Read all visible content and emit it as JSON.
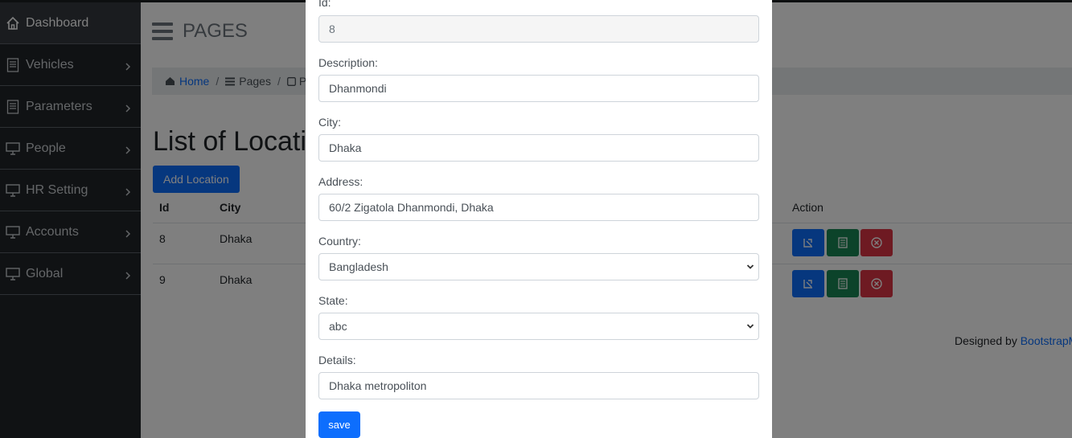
{
  "sidebar": {
    "items": [
      {
        "label": "Dashboard",
        "icon": "home-icon",
        "active": true
      },
      {
        "label": "Vehicles",
        "icon": "list-icon"
      },
      {
        "label": "Parameters",
        "icon": "list-icon"
      },
      {
        "label": "People",
        "icon": "monitor-icon"
      },
      {
        "label": "HR Setting",
        "icon": "monitor-icon"
      },
      {
        "label": "Accounts",
        "icon": "monitor-icon"
      },
      {
        "label": "Global",
        "icon": "monitor-icon"
      }
    ]
  },
  "header": {
    "title": "PAGES"
  },
  "breadcrumb": {
    "home": "Home",
    "pages": "Pages",
    "current": "P"
  },
  "main": {
    "list_title": "List of Locati",
    "add_button": "Add Location",
    "columns": {
      "id": "Id",
      "city": "City",
      "action": "Action"
    },
    "rows": [
      {
        "id": "8",
        "city": "Dhaka"
      },
      {
        "id": "9",
        "city": "Dhaka"
      }
    ],
    "ghost_text": "60/2 Zigatola Dhanmondi, Dhaka"
  },
  "footer": {
    "designed_by": "Designed by",
    "link": "BootstrapM"
  },
  "modal": {
    "fields": {
      "id": {
        "label": "Id:",
        "value": "8"
      },
      "description": {
        "label": "Description:",
        "value": "Dhanmondi"
      },
      "city": {
        "label": "City:",
        "value": "Dhaka"
      },
      "address": {
        "label": "Address:",
        "value": "60/2 Zigatola Dhanmondi, Dhaka"
      },
      "country": {
        "label": "Country:",
        "value": "Bangladesh"
      },
      "state": {
        "label": "State:",
        "value": "abc"
      },
      "details": {
        "label": "Details:",
        "value": "Dhaka metropoliton"
      }
    },
    "save_label": "save"
  },
  "colors": {
    "sidebar_bg": "#212529",
    "primary": "#0d6efd",
    "success": "#198754",
    "danger": "#dc3545"
  }
}
